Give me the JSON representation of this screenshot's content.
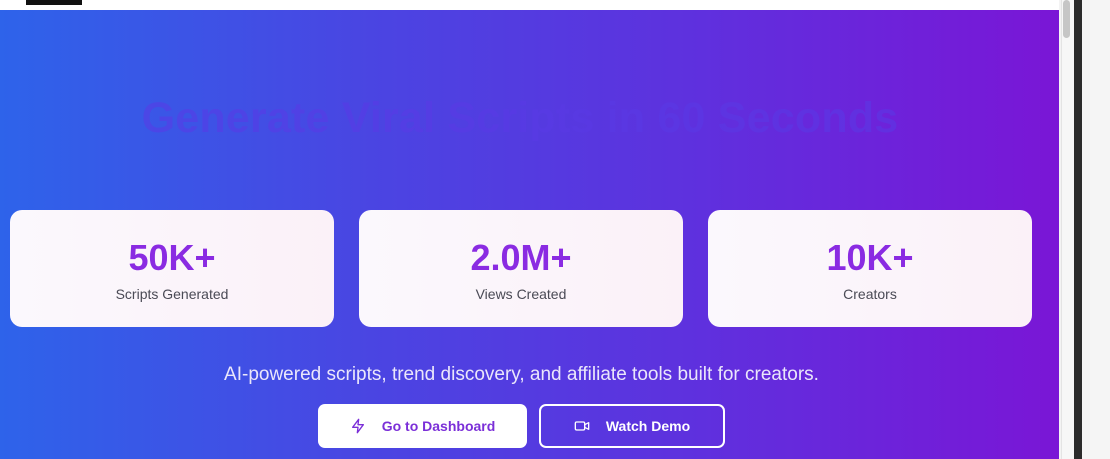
{
  "hero": {
    "title": "Generate Viral Scripts in 60 Seconds",
    "tagline": "AI-powered scripts, trend discovery, and affiliate tools built for creators."
  },
  "stats": [
    {
      "value": "50K+",
      "label": "Scripts Generated"
    },
    {
      "value": "2.0M+",
      "label": "Views Created"
    },
    {
      "value": "10K+",
      "label": "Creators"
    }
  ],
  "actions": {
    "primary_label": "Go to Dashboard",
    "primary_icon": "lightning-icon",
    "secondary_label": "Watch Demo",
    "secondary_icon": "video-camera-icon"
  },
  "colors": {
    "gradient_start": "#2e63ea",
    "gradient_end": "#7a16d6",
    "accent": "#8a2be2"
  }
}
